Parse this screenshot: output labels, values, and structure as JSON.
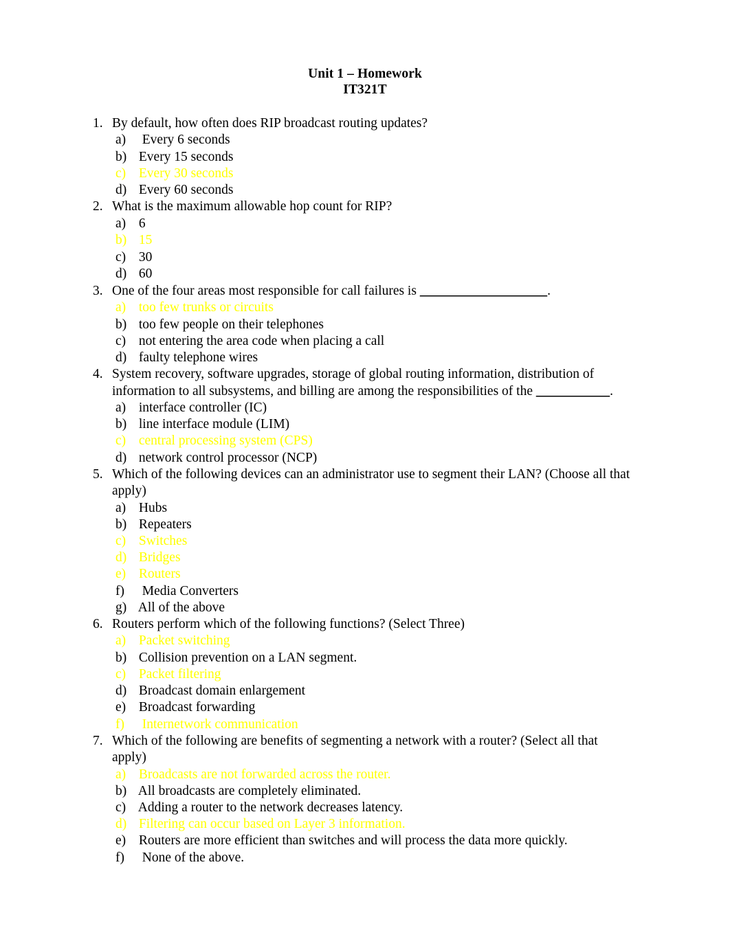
{
  "document": {
    "title": "Unit 1 – Homework",
    "subtitle": "IT321T",
    "answer_color": "#FFFF00",
    "text_color": "#000000",
    "background_color": "#FFFFFF"
  },
  "questions": [
    {
      "number": "1.",
      "text": "By default, how often does RIP broadcast routing updates?",
      "options": [
        {
          "letter": "a)",
          "text": "  Every 6 seconds",
          "answer": false
        },
        {
          "letter": "b)",
          "text": " Every 15 seconds",
          "answer": false
        },
        {
          "letter": "c)",
          "text": " Every 30 seconds",
          "answer": true
        },
        {
          "letter": "d)",
          "text": " Every 60 seconds",
          "answer": false
        }
      ]
    },
    {
      "number": "2.",
      "text": "What is the maximum allowable hop count for RIP?",
      "options": [
        {
          "letter": "a)",
          "text": " 6",
          "answer": false
        },
        {
          "letter": "b)",
          "text": " 15",
          "answer": true
        },
        {
          "letter": "c)",
          "text": " 30",
          "answer": false
        },
        {
          "letter": "d)",
          "text": " 60",
          "answer": false
        }
      ]
    },
    {
      "number": "3.",
      "text_before_blank": "One of the four areas most responsible for call failures is ",
      "blank": "___________________",
      "text_after_blank": ".",
      "options": [
        {
          "letter": "a)",
          "text": " too few trunks or circuits",
          "answer": true
        },
        {
          "letter": "b)",
          "text": " too few people on their telephones",
          "answer": false
        },
        {
          "letter": "c)",
          "text": " not entering the area code when placing a call",
          "answer": false
        },
        {
          "letter": "d)",
          "text": " faulty telephone wires",
          "answer": false
        }
      ]
    },
    {
      "number": "4.",
      "text_before_blank": "System recovery, software upgrades, storage of global routing information, distribution of information to all subsystems, and billing are among the responsibilities of the ",
      "blank": "___________",
      "text_after_blank": ".",
      "options": [
        {
          "letter": "a)",
          "text": " interface controller (IC)",
          "answer": false
        },
        {
          "letter": "b)",
          "text": " line interface module (LIM)",
          "answer": false
        },
        {
          "letter": "c)",
          "text": " central processing system (CPS)",
          "answer": true
        },
        {
          "letter": "d)",
          "text": " network control processor (NCP)",
          "answer": false
        }
      ]
    },
    {
      "number": "5.",
      "text": "Which of the following devices can an administrator use to segment their LAN? (Choose all that apply)",
      "options": [
        {
          "letter": "a)",
          "text": " Hubs",
          "answer": false
        },
        {
          "letter": "b)",
          "text": " Repeaters",
          "answer": false
        },
        {
          "letter": "c)",
          "text": " Switches",
          "answer": true
        },
        {
          "letter": "d)",
          "text": " Bridges",
          "answer": true
        },
        {
          "letter": "e)",
          "text": " Routers",
          "answer": true
        },
        {
          "letter": "f)",
          "text": "  Media Converters",
          "answer": false
        },
        {
          "letter": "g)",
          "text": " All of the above",
          "answer": false
        }
      ]
    },
    {
      "number": "6.",
      "text": "Routers perform which of the following functions? (Select Three)",
      "options": [
        {
          "letter": "a)",
          "text": " Packet switching",
          "answer": true
        },
        {
          "letter": "b)",
          "text": " Collision prevention on a LAN segment.",
          "answer": false
        },
        {
          "letter": "c)",
          "text": " Packet filtering",
          "answer": true
        },
        {
          "letter": "d)",
          "text": " Broadcast domain enlargement",
          "answer": false
        },
        {
          "letter": "e)",
          "text": " Broadcast forwarding",
          "answer": false
        },
        {
          "letter": "f)",
          "text": "  Internetwork communication",
          "answer": true
        }
      ]
    },
    {
      "number": "7.",
      "text": "Which of the following are benefits of segmenting a network with a router? (Select all that apply)",
      "options": [
        {
          "letter": "a)",
          "text": " Broadcasts are not forwarded across the router.",
          "answer": true
        },
        {
          "letter": "b)",
          "text": " All broadcasts are completely eliminated.",
          "answer": false
        },
        {
          "letter": "c)",
          "text": " Adding a router to the network decreases latency.",
          "answer": false
        },
        {
          "letter": "d)",
          "text": " Filtering can occur based on Layer 3 information.",
          "answer": true
        },
        {
          "letter": "e)",
          "text": " Routers are more efficient than switches and will process the data more quickly.",
          "answer": false
        },
        {
          "letter": "f)",
          "text": "  None of the above.",
          "answer": false
        }
      ]
    }
  ]
}
